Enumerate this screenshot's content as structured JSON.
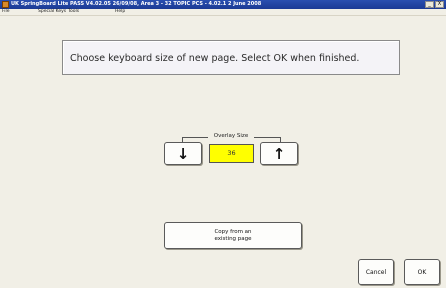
{
  "titlebar": {
    "title": "UK SpringBoard Lite PASS V4.02.05 26/09/08, Area 3 - 32 TOPIC PCS - 4.02.1 2 June 2008",
    "minimize": "_",
    "close": "X"
  },
  "menubar": {
    "items": [
      "File",
      "Special Keys",
      "Tools",
      "Help"
    ]
  },
  "instruction": {
    "text": "Choose keyboard size of new page.  Select OK when finished."
  },
  "overlay": {
    "label": "Overlay Size",
    "decrease": "↓",
    "value": "36",
    "increase": "↑"
  },
  "copy_button": {
    "line1": "Copy from an",
    "line2": "existing page"
  },
  "footer": {
    "cancel": "Cancel",
    "ok": "OK"
  }
}
